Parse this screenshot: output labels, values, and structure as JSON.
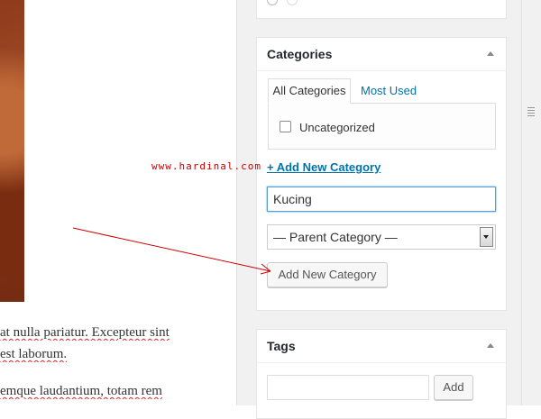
{
  "editor": {
    "line1": "at nulla pariatur. Excepteur sint",
    "line2": "est laborum.",
    "line3": "emque laudantium, totam rem"
  },
  "categories": {
    "title": "Categories",
    "tab_all": "All Categories",
    "tab_most_used": "Most Used",
    "items": [
      {
        "label": "Uncategorized",
        "checked": false
      }
    ],
    "add_link": "+ Add New Category",
    "new_name_value": "Kucing",
    "parent_select": "— Parent Category —",
    "add_button": "Add New Category"
  },
  "tags": {
    "title": "Tags",
    "add_button": "Add",
    "input_value": ""
  },
  "watermark": "www.hardinal.com",
  "colors": {
    "link": "#0073aa",
    "annotation": "#cc0000",
    "focus_border": "#5b9dd9"
  },
  "icons": {
    "box_toggle": "triangle-up-icon",
    "select_dropdown": "chevron-down-icon"
  }
}
